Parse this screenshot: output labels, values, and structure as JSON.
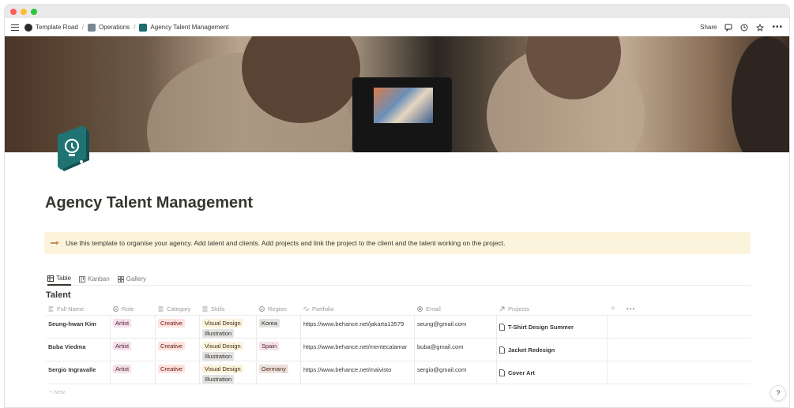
{
  "breadcrumb": [
    {
      "label": "Template Road",
      "icon": "template-road-logo-icon"
    },
    {
      "label": "Operations",
      "icon": "building-icon"
    },
    {
      "label": "Agency Talent Management",
      "icon": "page-icon"
    }
  ],
  "topbar": {
    "share_label": "Share"
  },
  "page": {
    "title": "Agency Talent Management",
    "callout": "Use this template to organise your agency. Add talent and clients. Add projects and link the project to the client and the talent working on the project."
  },
  "views": [
    {
      "label": "Table",
      "icon": "table-icon",
      "active": true
    },
    {
      "label": "Kanban",
      "icon": "kanban-icon",
      "active": false
    },
    {
      "label": "Gallery",
      "icon": "gallery-icon",
      "active": false
    }
  ],
  "database": {
    "title": "Talent",
    "columns": [
      "Full Name",
      "Role",
      "Category",
      "Skills",
      "Region",
      "Portfolio",
      "Email",
      "Projects"
    ],
    "rows": [
      {
        "name": "Seung-hwan Kim",
        "role": "Artist",
        "category": "Creative",
        "skills": [
          "Visual Design",
          "Illustration"
        ],
        "region": "Korea",
        "portfolio": "https://www.behance.net/jakarta13579",
        "email": "seung@gmail.com",
        "project": "T-Shirt Design Summer"
      },
      {
        "name": "Buba Viedma",
        "role": "Artist",
        "category": "Creative",
        "skills": [
          "Visual Design",
          "Illustration"
        ],
        "region": "Spain",
        "portfolio": "https://www.behance.net/mentecalamar",
        "email": "buba@gmail.com",
        "project": "Jacket Redesign"
      },
      {
        "name": "Sergio Ingravalle",
        "role": "Artist",
        "category": "Creative",
        "skills": [
          "Visual Design",
          "Illustration"
        ],
        "region": "Germany",
        "portfolio": "https://www.behance.net/maivisto",
        "email": "sergio@gmail.com",
        "project": "Cover Art"
      }
    ],
    "new_label": "+ New"
  },
  "help_label": "?",
  "colors": {
    "callout_bg": "#fbf3db",
    "tag_pink": "#f5e0e9",
    "tag_yellow": "#fbf3db",
    "tag_gray": "#e3e2e0",
    "icon_teal": "#1e6b6b"
  }
}
